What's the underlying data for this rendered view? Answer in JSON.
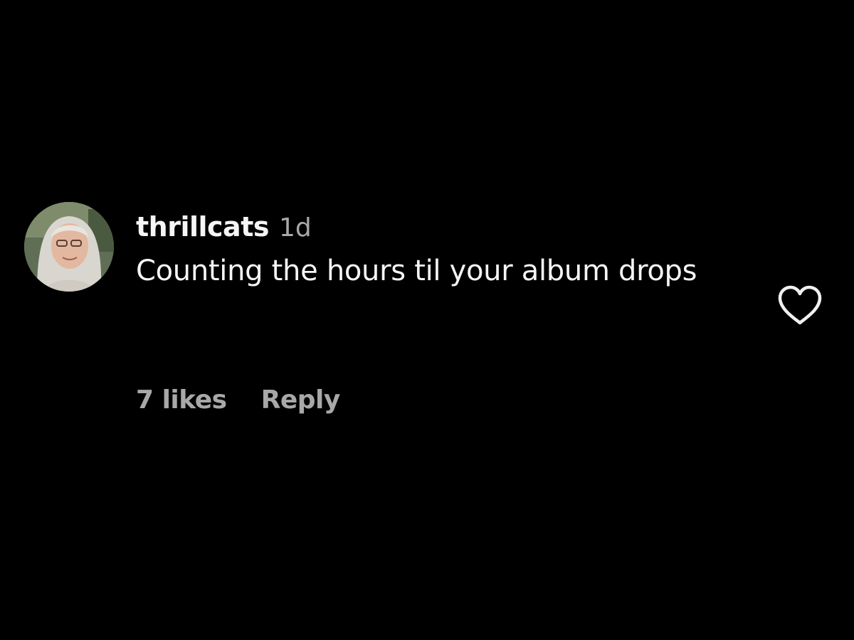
{
  "comment": {
    "username": "thrillcats",
    "time": "1d",
    "text": "Counting the hours til your album drops",
    "likes": "7 likes",
    "reply_label": "Reply",
    "like_icon": "heart-outline-icon"
  },
  "colors": {
    "background": "#000000",
    "primary_text": "#f5f5f5",
    "secondary_text": "#a8a8a8"
  }
}
